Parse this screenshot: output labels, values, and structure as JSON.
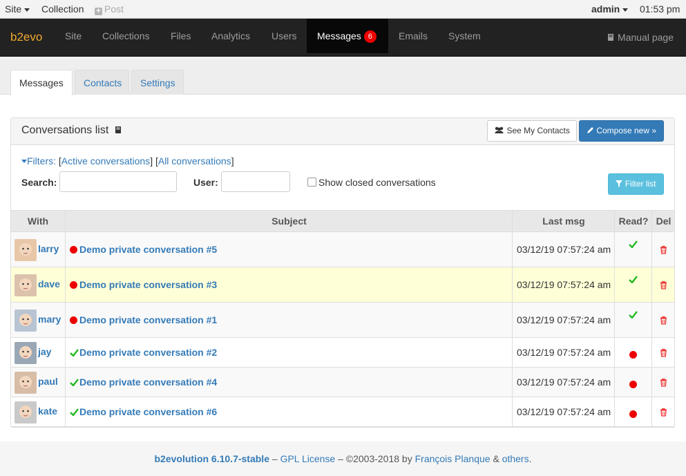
{
  "topbar": {
    "site_menu": "Site",
    "collection": "Collection",
    "post": "Post",
    "user": "admin",
    "time": "01:53 pm"
  },
  "navbar": {
    "brand": "b2evo",
    "items": [
      "Site",
      "Collections",
      "Files",
      "Analytics",
      "Users",
      "Messages",
      "Emails",
      "System"
    ],
    "messages_badge": "6",
    "manual": "Manual page"
  },
  "tabs": [
    "Messages",
    "Contacts",
    "Settings"
  ],
  "panel": {
    "title": "Conversations list",
    "see_contacts": "See My Contacts",
    "compose": "Compose new »"
  },
  "filters": {
    "label": "Filters:",
    "active": "Active conversations",
    "all": "All conversations",
    "search_label": "Search:",
    "search_value": "",
    "user_label": "User:",
    "user_value": "",
    "show_closed": "Show closed conversations",
    "show_closed_checked": false,
    "filter_button": "Filter list"
  },
  "table": {
    "headers": [
      "With",
      "Subject",
      "Last msg",
      "Read?",
      "Del"
    ],
    "rows": [
      {
        "user": "larry",
        "subject": "Demo private conversation #5",
        "last_msg": "03/12/19 07:57:24 am",
        "unread_by_me": true,
        "read": true
      },
      {
        "user": "dave",
        "subject": "Demo private conversation #3",
        "last_msg": "03/12/19 07:57:24 am",
        "unread_by_me": true,
        "read": true
      },
      {
        "user": "mary",
        "subject": "Demo private conversation #1",
        "last_msg": "03/12/19 07:57:24 am",
        "unread_by_me": true,
        "read": true
      },
      {
        "user": "jay",
        "subject": "Demo private conversation #2",
        "last_msg": "03/12/19 07:57:24 am",
        "unread_by_me": false,
        "read": false
      },
      {
        "user": "paul",
        "subject": "Demo private conversation #4",
        "last_msg": "03/12/19 07:57:24 am",
        "unread_by_me": false,
        "read": false
      },
      {
        "user": "kate",
        "subject": "Demo private conversation #6",
        "last_msg": "03/12/19 07:57:24 am",
        "unread_by_me": false,
        "read": false
      }
    ]
  },
  "footer": {
    "product": "b2evolution 6.10.7-stable",
    "sep1": " – ",
    "license": "GPL License",
    "copy": " – ©2003-2018 by ",
    "author": "François Planque",
    "amp": " & ",
    "others": "others",
    "end": "."
  },
  "colors": {
    "accent": "#337ab7",
    "brand": "#f0a830",
    "unread_red": "#ee0000",
    "check_green": "#22b922",
    "highlight_row": "#ffffd7"
  }
}
